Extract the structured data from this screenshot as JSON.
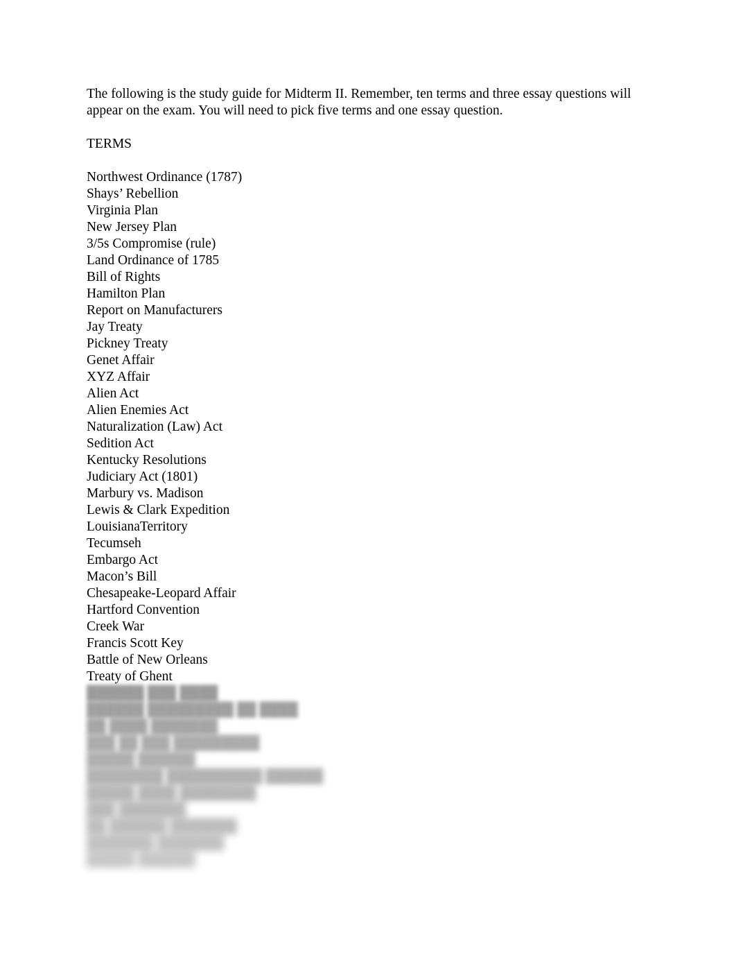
{
  "document": {
    "intro_paragraph": "The following is the study guide for Midterm II. Remember, ten terms and three essay questions will appear on the exam. You will need to pick five terms and one essay question.",
    "section_heading": "TERMS",
    "terms": [
      "Northwest Ordinance (1787)",
      "Shays’ Rebellion",
      "Virginia Plan",
      "New Jersey Plan",
      "3/5s Compromise (rule)",
      "Land Ordinance of 1785",
      "Bill of Rights",
      "Hamilton Plan",
      "Report on Manufacturers",
      "Jay Treaty",
      "Pickney Treaty",
      "Genet Affair",
      "XYZ Affair",
      "Alien Act",
      "Alien Enemies Act",
      "Naturalization (Law) Act",
      "Sedition Act",
      "Kentucky Resolutions",
      "Judiciary Act (1801)",
      "Marbury vs. Madison",
      "Lewis & Clark Expedition",
      "LouisianaTerritory",
      "Tecumseh",
      "Embargo Act",
      "Macon’s Bill",
      "Chesapeake-Leopard Affair",
      "Hartford Convention",
      "Creek War",
      "Francis Scott Key",
      "Battle of New Orleans",
      "Treaty of Ghent"
    ],
    "redacted_terms": [
      "██████ ███ ████",
      "██████ █████████ ██ ████",
      "██ ████ ███████",
      "███ ██ ███ █████████",
      "█████ ██████",
      "████████ ██████████ ██████",
      "█████ ████ ████████",
      "███ ███████",
      "██ ██████ ███████",
      "███████ ███████",
      "█████ ██████"
    ]
  }
}
